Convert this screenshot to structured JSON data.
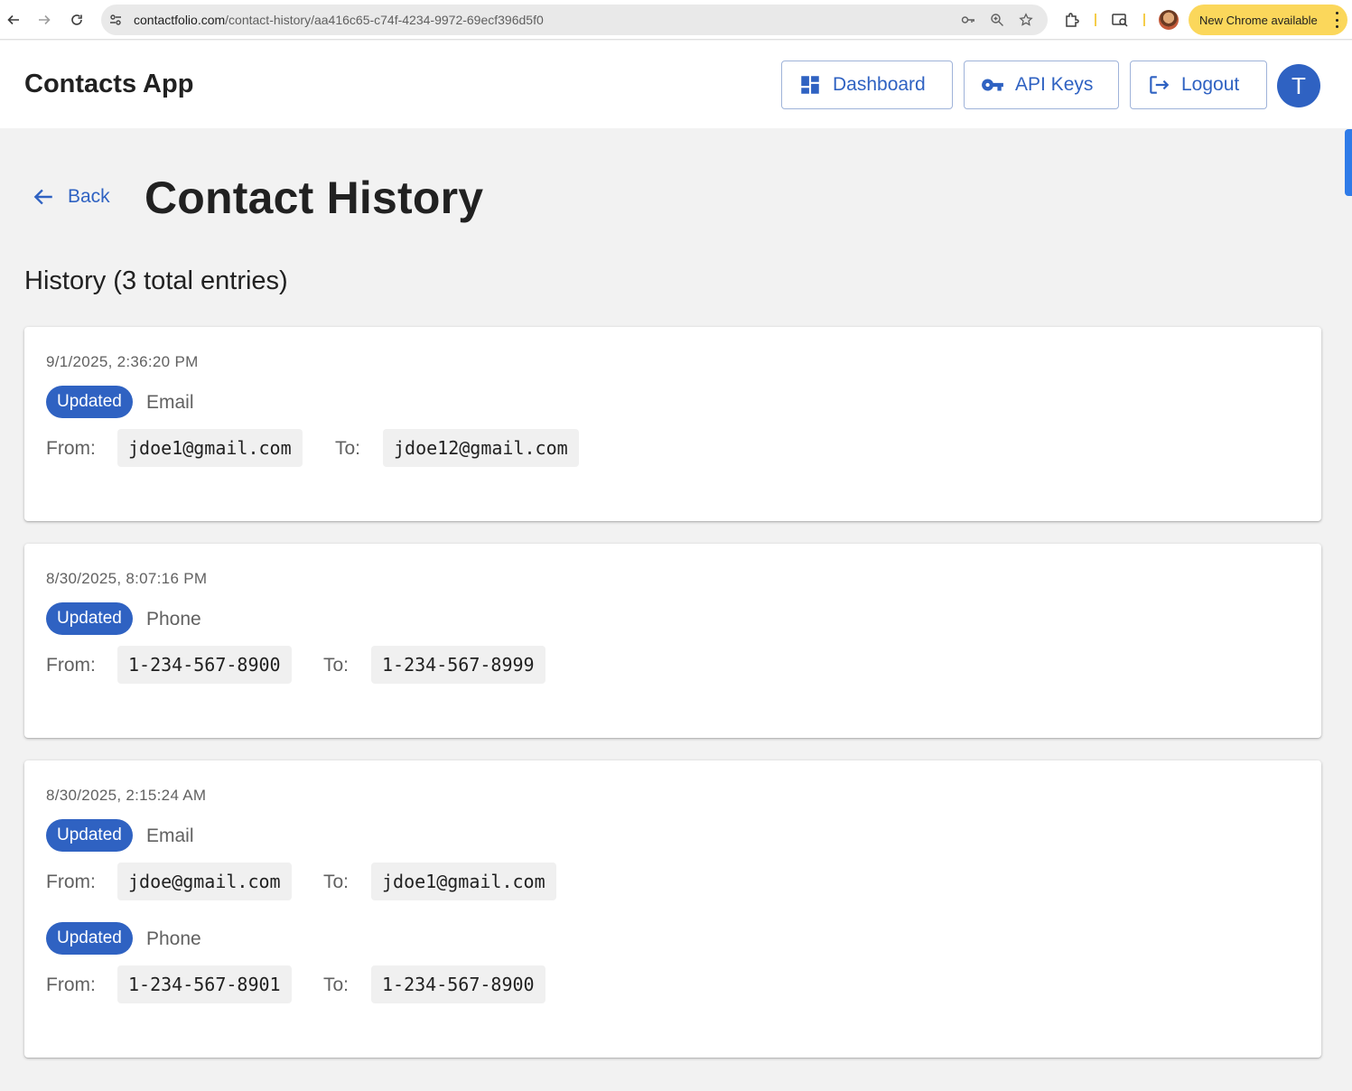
{
  "browser": {
    "url_host": "contactfolio.com",
    "url_path": "/contact-history/aa416c65-c74f-4234-9972-69ecf396d5f0",
    "update_label": "New Chrome available"
  },
  "header": {
    "app_title": "Contacts App",
    "dashboard_label": "Dashboard",
    "apikeys_label": "API Keys",
    "logout_label": "Logout",
    "avatar_initial": "T"
  },
  "page": {
    "back_label": "Back",
    "title": "Contact History",
    "section_title": "History (3 total entries)"
  },
  "history": [
    {
      "timestamp": "9/1/2025, 2:36:20 PM",
      "changes": [
        {
          "badge": "Updated",
          "field": "Email",
          "from_label": "From:",
          "from": "jdoe1@gmail.com",
          "to_label": "To:",
          "to": "jdoe12@gmail.com"
        }
      ]
    },
    {
      "timestamp": "8/30/2025, 8:07:16 PM",
      "changes": [
        {
          "badge": "Updated",
          "field": "Phone",
          "from_label": "From:",
          "from": "1-234-567-8900",
          "to_label": "To:",
          "to": "1-234-567-8999"
        }
      ]
    },
    {
      "timestamp": "8/30/2025, 2:15:24 AM",
      "changes": [
        {
          "badge": "Updated",
          "field": "Email",
          "from_label": "From:",
          "from": "jdoe@gmail.com",
          "to_label": "To:",
          "to": "jdoe1@gmail.com"
        },
        {
          "badge": "Updated",
          "field": "Phone",
          "from_label": "From:",
          "from": "1-234-567-8901",
          "to_label": "To:",
          "to": "1-234-567-8900"
        }
      ]
    }
  ],
  "colors": {
    "primary": "#2f62c2",
    "background": "#f2f2f2",
    "value_bg": "#f0f0f0",
    "update_pill": "#fbd75b"
  }
}
